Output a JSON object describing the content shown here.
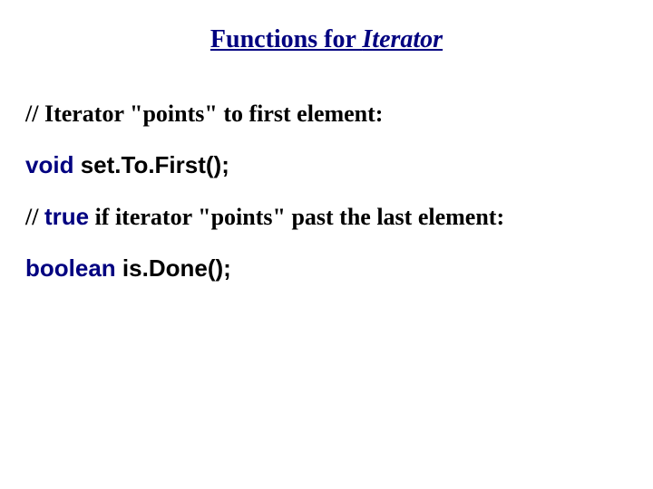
{
  "title": {
    "prefix": "Functions for ",
    "iterator_word": "Iterator"
  },
  "lines": {
    "comment1_prefix": "// ",
    "comment1_text": "Iterator \"points\" to first element:",
    "sig1_kw": "void",
    "sig1_space": " ",
    "sig1_name": "set.To.First();",
    "comment2_prefix": "// ",
    "comment2_kw": "true",
    "comment2_rest": " if iterator \"points\" past the last element:",
    "sig2_kw": "boolean",
    "sig2_space": " ",
    "sig2_name": "is.Done();"
  }
}
